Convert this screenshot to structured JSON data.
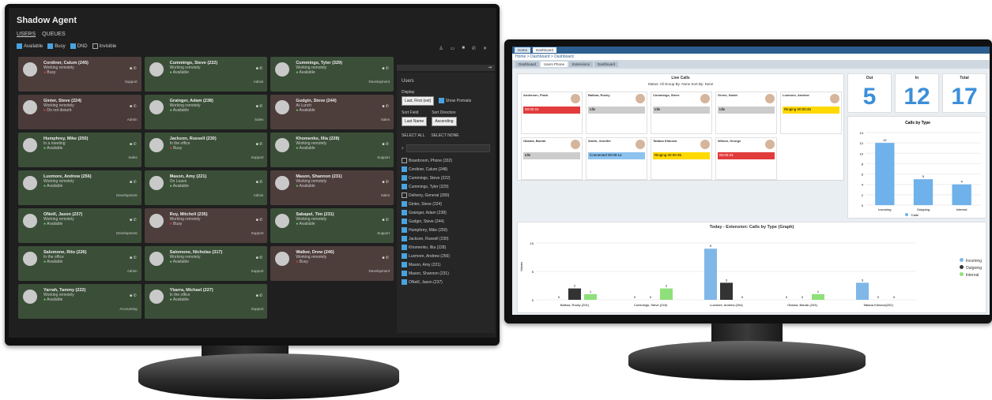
{
  "left": {
    "app_title": "Shadow Agent",
    "tabs": [
      "USERS",
      "QUEUES"
    ],
    "status_filters": [
      "Available",
      "Busy",
      "DND",
      "Invisible"
    ],
    "cards": [
      {
        "name": "Cordiner, Calum (245)",
        "state": "Working remotely",
        "line": "Busy",
        "dept": "Support",
        "status": "busy"
      },
      {
        "name": "Cummings, Steve (222)",
        "state": "Working remotely",
        "line": "Available",
        "dept": "Admin",
        "status": "available"
      },
      {
        "name": "Cummings, Tyler (329)",
        "state": "Working remotely",
        "line": "Available",
        "dept": "Development",
        "status": "available"
      },
      {
        "name": "Ginter, Steve (224)",
        "state": "Working remotely",
        "line": "Do not disturb",
        "dept": "Admin",
        "status": "dnd"
      },
      {
        "name": "Grainger, Adam (238)",
        "state": "Working remotely",
        "line": "Available",
        "dept": "Sales",
        "status": "available"
      },
      {
        "name": "Gudgin, Steve (244)",
        "state": "At Lunch",
        "line": "Available",
        "dept": "Sales",
        "status": "busy"
      },
      {
        "name": "Humphrey, Mike (250)",
        "state": "In a meeting",
        "line": "Available",
        "dept": "Sales",
        "status": "available"
      },
      {
        "name": "Jackson, Russell (230)",
        "state": "In the office",
        "line": "Busy",
        "dept": "Support",
        "status": "available"
      },
      {
        "name": "Khomenko, Illia (228)",
        "state": "Working remotely",
        "line": "Available",
        "dept": "Support",
        "status": "available"
      },
      {
        "name": "Luxmore, Andrew (256)",
        "state": "Working remotely",
        "line": "Available",
        "dept": "Development",
        "status": "available"
      },
      {
        "name": "Mason, Amy (221)",
        "state": "On Leave",
        "line": "Available",
        "dept": "Admin",
        "status": "available"
      },
      {
        "name": "Mason, Shannon (231)",
        "state": "Working remotely",
        "line": "Available",
        "dept": "Sales",
        "status": "busy"
      },
      {
        "name": "ONeill, Jason (237)",
        "state": "Working remotely",
        "line": "Available",
        "dept": "Development",
        "status": "available"
      },
      {
        "name": "Roy, Mitchell (235)",
        "state": "Working remotely",
        "line": "Busy",
        "dept": "Support",
        "status": "busy"
      },
      {
        "name": "Sabapel, Tim (231)",
        "state": "Working remotely",
        "line": "Available",
        "dept": "Support",
        "status": "available"
      },
      {
        "name": "Salomone, Rito (226)",
        "state": "In the office",
        "line": "Available",
        "dept": "Admin",
        "status": "available"
      },
      {
        "name": "Salomone, Nicholas (317)",
        "state": "Working remotely",
        "line": "Available",
        "dept": "Support",
        "status": "available"
      },
      {
        "name": "Walker, Drew (246)",
        "state": "Working remotely",
        "line": "Busy",
        "dept": "Development",
        "status": "busy"
      },
      {
        "name": "Yarrah, Tammy (222)",
        "state": "Working remotely",
        "line": "Available",
        "dept": "Accounting",
        "status": "available"
      },
      {
        "name": "Ybarra, Michael (227)",
        "state": "In the office",
        "line": "Available",
        "dept": "Support",
        "status": "available"
      }
    ],
    "panel": {
      "title": "Users",
      "display_label": "Display",
      "display_value": "Last, First (ext)",
      "show_portraits": "Show Portraits",
      "sort_field_label": "Sort Field",
      "sort_field_value": "Last Name",
      "sort_dir_label": "Sort Direction",
      "sort_dir_value": "Ascending",
      "select_all": "SELECT ALL",
      "select_none": "SELECT NONE",
      "users": [
        "Boardroom, Phone (332)",
        "Cordiner, Calum (248)",
        "Cummings, Steve (222)",
        "Cummings, Tyler (329)",
        "Delivery, General (280)",
        "Ginter, Steve (224)",
        "Grainger, Adam (238)",
        "Gudgin, Steve (244)",
        "Humphrey, Mike (250)",
        "Jackson, Russell (230)",
        "Khomenko, Illia (228)",
        "Luxmore, Andrew (256)",
        "Mason, Amy (221)",
        "Mason, Shannon (231)",
        "ONeill, Jason (237)"
      ]
    }
  },
  "right": {
    "tabs": [
      "Home",
      "Dashboard"
    ],
    "breadcrumb": "Home > Dashboard > Dashboard",
    "subtabs": [
      "Dashboard",
      "Users Phone",
      "Extensions",
      "Dashboard"
    ],
    "live_calls": {
      "title": "Live Calls",
      "filters": "Status: All   Group By: None   Sort By: None",
      "cards": [
        {
          "name": "Anderson, Flash",
          "bar": "00:00:24",
          "style": "red"
        },
        {
          "name": "Balboa, Rocky",
          "bar": "Idle",
          "style": "idle"
        },
        {
          "name": "Cummings, Steve",
          "bar": "Idle",
          "style": "idle"
        },
        {
          "name": "Green, Sarah",
          "bar": "Idle",
          "style": "idle"
        },
        {
          "name": "Luxmore, Andrew",
          "bar": "Ringing 00:00:45",
          "style": "yellow"
        },
        {
          "name": "Obama, Barrak",
          "bar": "Idle",
          "style": "idle"
        },
        {
          "name": "Smith, Jennifer",
          "bar": "Connected 00:00:12",
          "style": "blue"
        },
        {
          "name": "Tatiana Klimova",
          "bar": "Ringing 00:00:35",
          "style": "yellow"
        },
        {
          "name": "Wilson, George",
          "bar": "00:00:23",
          "style": "red"
        }
      ]
    },
    "stats": [
      {
        "label": "Out",
        "value": "5"
      },
      {
        "label": "In",
        "value": "12"
      },
      {
        "label": "Total",
        "value": "17"
      }
    ],
    "calls_by_type": {
      "title": "Calls by Type",
      "legend": "'Calls'"
    },
    "graph_title": "Today - Extension: Calls by Type (Graph)",
    "legend": [
      {
        "label": "Incoming",
        "color": "#7fb7e8"
      },
      {
        "label": "Outgoing",
        "color": "#333333"
      },
      {
        "label": "Internal",
        "color": "#8fe07a"
      }
    ]
  },
  "chart_data": [
    {
      "type": "bar",
      "title": "Calls by Type",
      "categories": [
        "Incoming",
        "Outgoing",
        "Internal"
      ],
      "values": [
        12,
        5,
        4
      ],
      "ylim": [
        0,
        14
      ],
      "legend": "'Calls'"
    },
    {
      "type": "bar",
      "title": "Today - Extension: Calls by Type (Graph)",
      "categories": [
        "Balboa, Rocky (201)",
        "Cummings, Steve (218)",
        "Luxmore, Andrew (204)",
        "Obama, Barrak (203)",
        "Tatiana Klimova(202)"
      ],
      "series": [
        {
          "name": "Incoming",
          "values": [
            0,
            0,
            9,
            0,
            3
          ]
        },
        {
          "name": "Outgoing",
          "values": [
            2,
            0,
            3,
            0,
            0
          ]
        },
        {
          "name": "Internal",
          "values": [
            1,
            2,
            0,
            1,
            0
          ]
        }
      ],
      "ylim": [
        0,
        10
      ],
      "ylabel": "Values"
    }
  ]
}
